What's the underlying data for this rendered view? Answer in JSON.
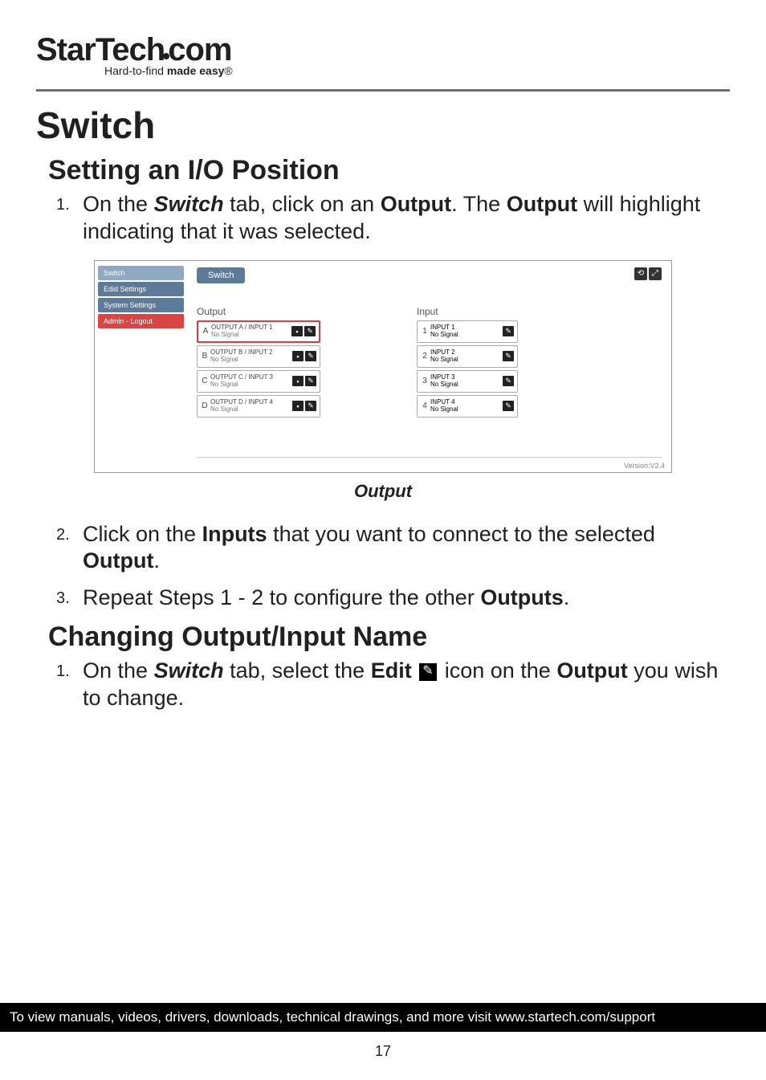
{
  "logo": {
    "text_part1": "StarTech",
    "text_part2": "com",
    "tagline_prefix": "Hard-to-find ",
    "tagline_bold": "made easy",
    "tagline_suffix": "®"
  },
  "title": "Switch",
  "section1": {
    "heading": "Setting an I/O Position",
    "step1_prefix": "On the ",
    "step1_switch": "Switch",
    "step1_mid": " tab, click on an ",
    "step1_output": "Output",
    "step1_mid2": ". The ",
    "step1_output2": "Output",
    "step1_suffix": " will highlight indicating that it was selected."
  },
  "screenshot": {
    "sidebar": {
      "items": [
        "Switch",
        "Edid Settings",
        "System Settings",
        "Admin - Logout"
      ]
    },
    "pill": "Switch",
    "output_header": "Output",
    "input_header": "Input",
    "outputs": [
      {
        "letter": "A",
        "line1": "OUTPUT A   /   INPUT 1",
        "line2": "No Signal",
        "selected": true
      },
      {
        "letter": "B",
        "line1": "OUTPUT B   /   INPUT 2",
        "line2": "No Signal",
        "selected": false
      },
      {
        "letter": "C",
        "line1": "OUTPUT C   /   INPUT 3",
        "line2": "No Signal",
        "selected": false
      },
      {
        "letter": "D",
        "line1": "OUTPUT D   /   INPUT 4",
        "line2": "No Signal",
        "selected": false
      }
    ],
    "inputs": [
      {
        "num": "1",
        "line1": "INPUT 1",
        "line2": "No Signal"
      },
      {
        "num": "2",
        "line1": "INPUT 2",
        "line2": "No Signal"
      },
      {
        "num": "3",
        "line1": "INPUT 3",
        "line2": "No Signal"
      },
      {
        "num": "4",
        "line1": "INPUT 4",
        "line2": "No Signal"
      }
    ],
    "version": "Version:V2.4"
  },
  "caption": "Output",
  "step2_prefix": "Click on the ",
  "step2_inputs": "Inputs",
  "step2_mid": " that you want to connect to the selected ",
  "step2_output": "Output",
  "step2_suffix": ".",
  "step3_prefix": "Repeat Steps 1 - 2 to configure the other ",
  "step3_outputs": "Outputs",
  "step3_suffix": ".",
  "section2": {
    "heading": "Changing Output/Input Name",
    "step1_prefix": "On the ",
    "step1_switch": "Switch",
    "step1_mid": " tab, select the ",
    "step1_edit": "Edit",
    "step1_mid2": " icon on the ",
    "step1_output": "Output",
    "step1_suffix": " you wish to change."
  },
  "footer": "To view manuals, videos, drivers, downloads, technical drawings, and more visit www.startech.com/support",
  "page_number": "17"
}
